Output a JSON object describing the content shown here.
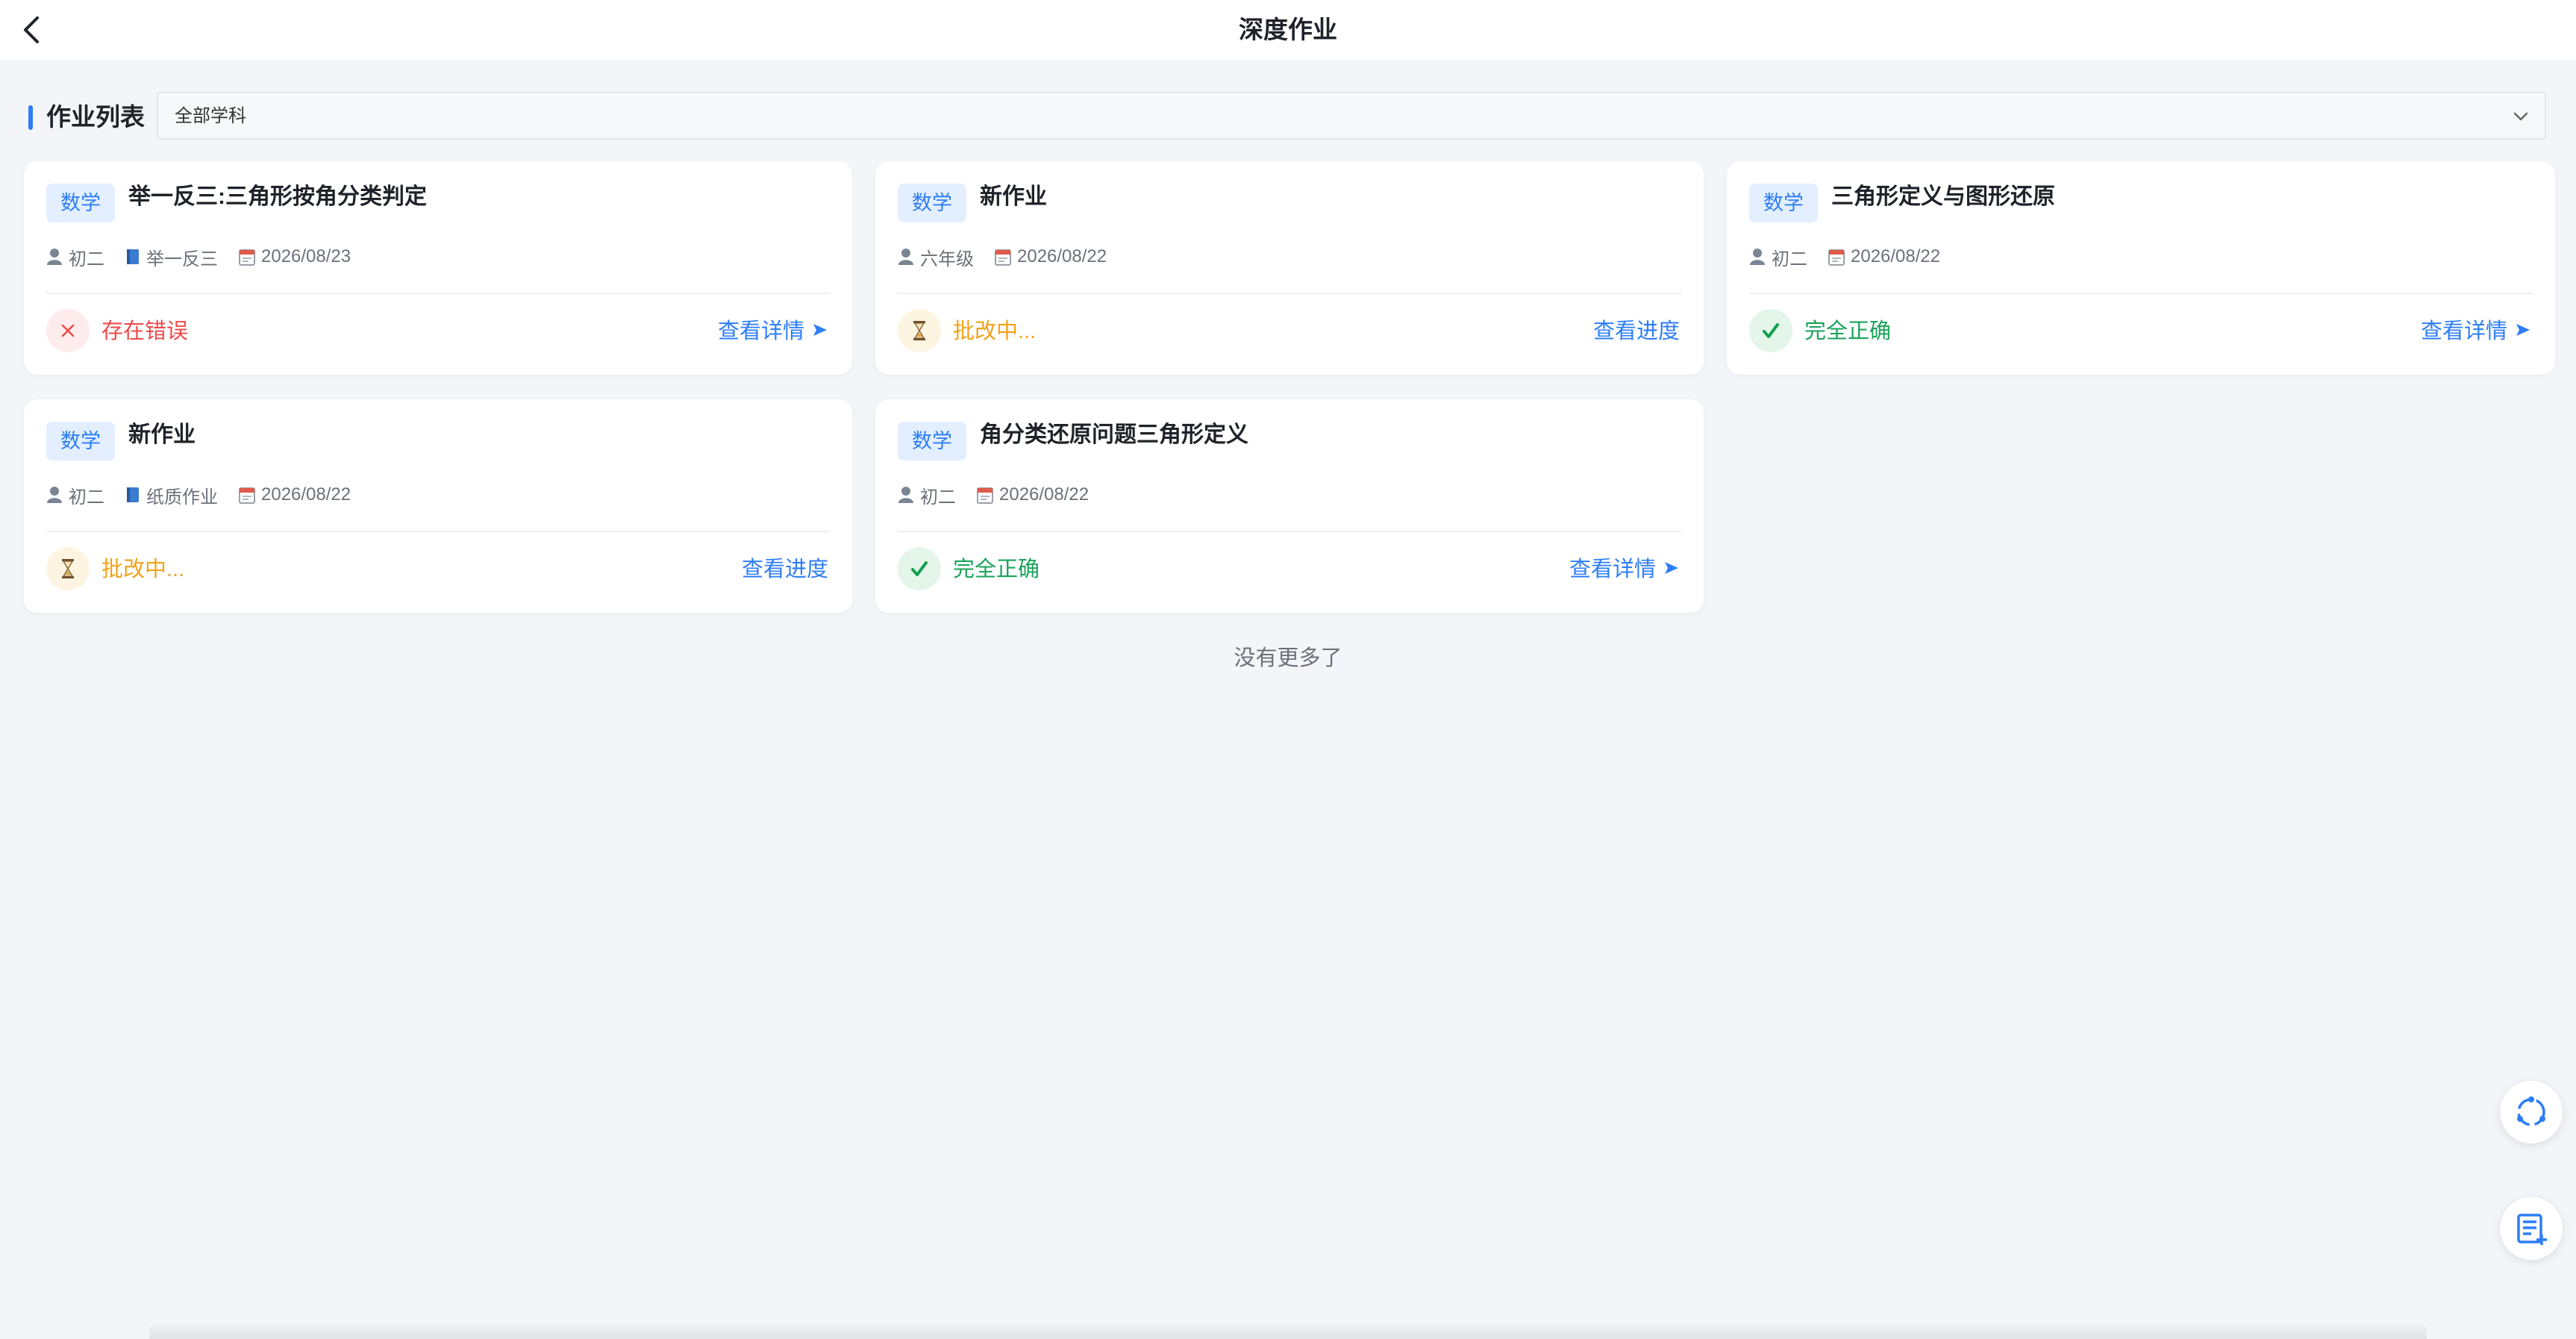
{
  "header": {
    "title": "深度作业"
  },
  "section": {
    "title": "作业列表",
    "filter_value": "全部学科"
  },
  "cards": [
    {
      "subject": "数学",
      "title": "举一反三:三角形按角分类判定",
      "grade": "初二",
      "book": "举一反三",
      "date": "2026/08/23",
      "status": "存在错误",
      "status_kind": "error",
      "action": "查看详情",
      "status_color": "#ee4b4b"
    },
    {
      "subject": "数学",
      "title": "新作业",
      "grade": "六年级",
      "date": "2026/08/22",
      "status": "批改中...",
      "status_kind": "pending",
      "action": "查看进度",
      "status_color": "#f0a21b"
    },
    {
      "subject": "数学",
      "title": "三角形定义与图形还原",
      "grade": "初二",
      "date": "2026/08/22",
      "status": "完全正确",
      "status_kind": "correct",
      "action": "查看详情",
      "status_color": "#1aa35a"
    },
    {
      "subject": "数学",
      "title": "新作业",
      "grade": "初二",
      "book": "纸质作业",
      "date": "2026/08/22",
      "status": "批改中...",
      "status_kind": "pending",
      "action": "查看进度",
      "status_color": "#f0a21b"
    },
    {
      "subject": "数学",
      "title": "角分类还原问题三角形定义",
      "grade": "初二",
      "date": "2026/08/22",
      "status": "完全正确",
      "status_kind": "correct",
      "action": "查看详情",
      "status_color": "#1aa35a"
    }
  ],
  "footer": {
    "end_text": "没有更多了"
  },
  "icons": {
    "back": "back-arrow-icon",
    "dropdown": "chevron-down-icon",
    "grade": "user-icon",
    "book": "book-icon",
    "date": "calendar-icon",
    "error": "close-icon",
    "pending": "hourglass-icon",
    "correct": "checkmark-icon",
    "link": "arrow-right-icon",
    "float_top": "refresh-icon",
    "float_bottom": "add-list-icon"
  },
  "colors": {
    "accent": "#2d7df6",
    "error": "#ee4b4b",
    "pending": "#f0a21b",
    "correct": "#1aa35a",
    "tag_bg": "#e3efff",
    "page_bg": "#f4f5f8"
  }
}
